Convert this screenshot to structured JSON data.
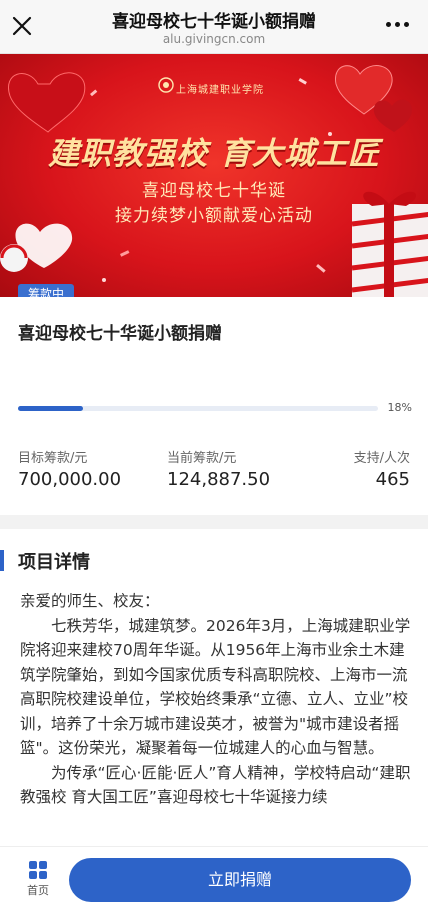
{
  "nav": {
    "title": "喜迎母校七十华诞小额捐赠",
    "url": "alu.givingcn.com"
  },
  "banner": {
    "school_name": "上海城建职业学院",
    "headline": "建职教强校  育大城工匠",
    "line1": "喜迎母校七十华诞",
    "line2": "接力续梦小额献爱心活动"
  },
  "project": {
    "status": "筹款中",
    "title": "喜迎母校七十华诞小额捐赠",
    "progress_percent": 18,
    "progress_label": "18%",
    "stats": [
      {
        "label": "目标筹款/元",
        "value": "700,000.00"
      },
      {
        "label": "当前筹款/元",
        "value": "124,887.50"
      },
      {
        "label": "支持/人次",
        "value": "465"
      }
    ]
  },
  "details": {
    "heading": "项目详情",
    "greeting": "亲爱的师生、校友：",
    "paragraph1": "七秩芳华，城建筑梦。2026年3月，上海城建职业学院将迎来建校70周年华诞。从1956年上海市业余土木建筑学院肇始，到如今国家优质专科高职院校、上海市一流高职院校建设单位，学校始终秉承“立德、立人、立业”校训，培养了十余万城市建设英才，被誉为\"城市建设者摇篮\"。这份荣光，凝聚着每一位城建人的心血与智慧。",
    "paragraph2": "为传承“匠心·匠能·匠人”育人精神，学校特启动“建职教强校 育大国工匠”喜迎母校七十华诞接力续"
  },
  "bottom": {
    "home_label": "首页",
    "donate_label": "立即捐赠"
  },
  "colors": {
    "accent": "#2d63c8",
    "banner_red": "#d8141b",
    "gold": "#ffe2a0"
  }
}
